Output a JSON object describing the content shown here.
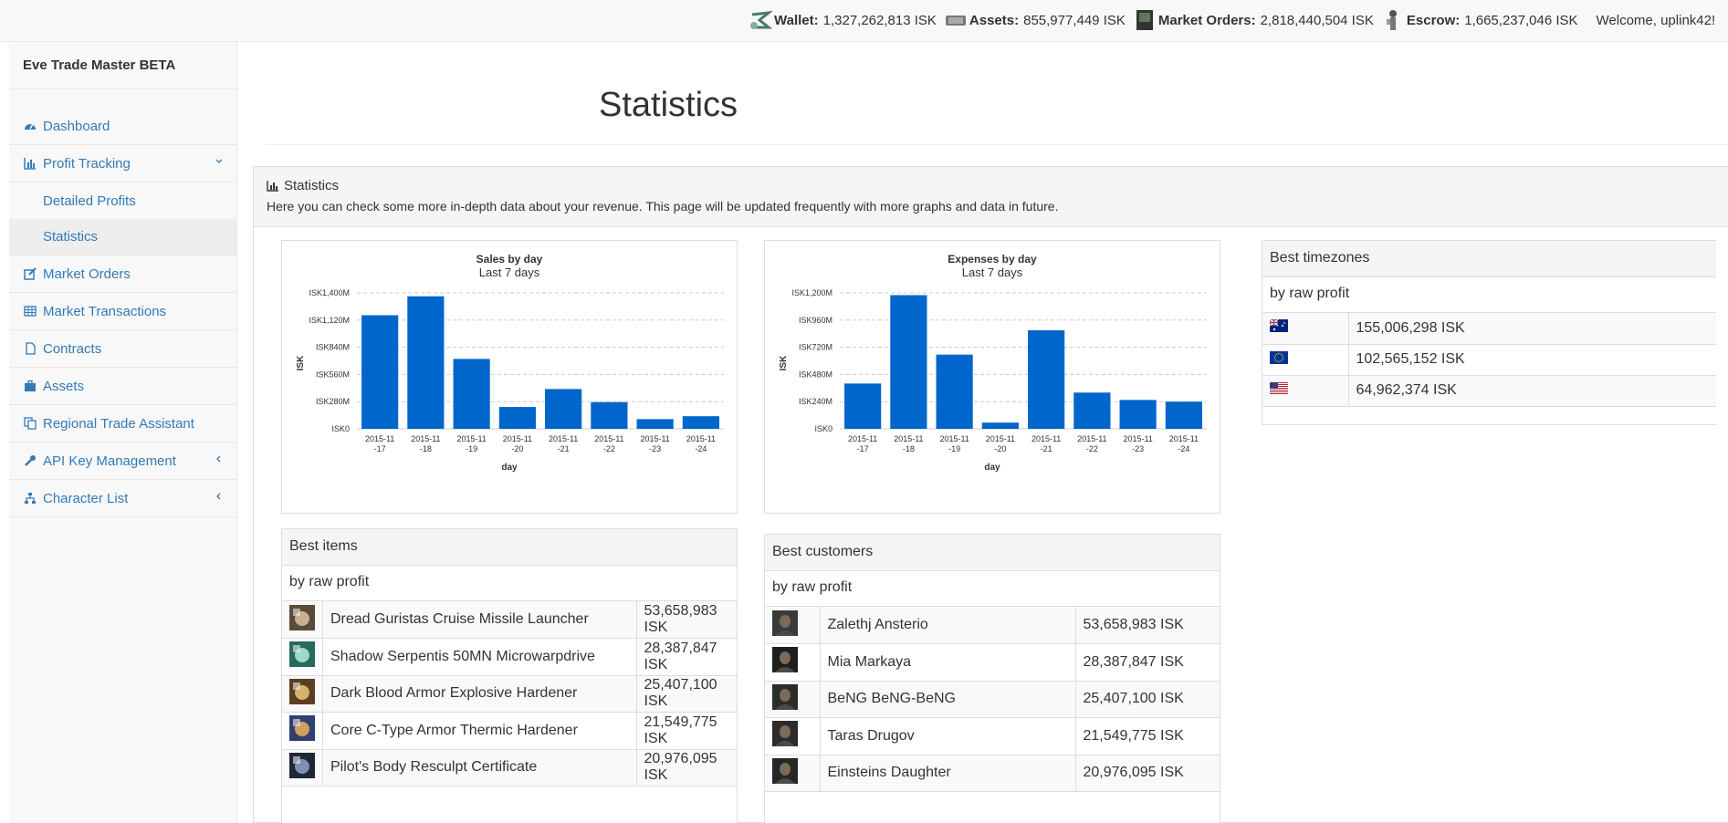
{
  "topbar": {
    "wallet_label": "Wallet:",
    "wallet_value": "1,327,262,813 ISK",
    "assets_label": "Assets:",
    "assets_value": "855,977,449 ISK",
    "orders_label": "Market Orders:",
    "orders_value": "2,818,440,504 ISK",
    "escrow_label": "Escrow:",
    "escrow_value": "1,665,237,046 ISK",
    "welcome": "Welcome, uplink42!"
  },
  "sidebar": {
    "brand": "Eve Trade Master BETA",
    "items": [
      {
        "label": "Dashboard",
        "icon": "dashboard-icon"
      },
      {
        "label": "Profit Tracking",
        "icon": "bar-chart-icon"
      },
      {
        "label": "Detailed Profits"
      },
      {
        "label": "Statistics"
      },
      {
        "label": "Market Orders",
        "icon": "edit-icon"
      },
      {
        "label": "Market Transactions",
        "icon": "table-icon"
      },
      {
        "label": "Contracts",
        "icon": "file-icon"
      },
      {
        "label": "Assets",
        "icon": "briefcase-icon"
      },
      {
        "label": "Regional Trade Assistant",
        "icon": "copy-icon"
      },
      {
        "label": "API Key Management",
        "icon": "wrench-icon"
      },
      {
        "label": "Character List",
        "icon": "sitemap-icon"
      }
    ]
  },
  "page": {
    "title": "Statistics",
    "panel_title": "Statistics",
    "panel_desc": "Here you can check some more in-depth data about your revenue. This page will be updated frequently with more graphs and data in future."
  },
  "chart_data": [
    {
      "type": "bar",
      "title": "Sales by day",
      "subtitle": "Last 7 days",
      "xlabel": "day",
      "ylabel": "ISK",
      "categories": [
        "2015-11-17",
        "2015-11-18",
        "2015-11-19",
        "2015-11-20",
        "2015-11-21",
        "2015-11-22",
        "2015-11-23",
        "2015-11-24"
      ],
      "values": [
        1170,
        1365,
        720,
        225,
        410,
        275,
        100,
        130
      ],
      "yticks": [
        "ISK0",
        "ISK280M",
        "ISK560M",
        "ISK840M",
        "ISK1,120M",
        "ISK1,400M"
      ],
      "ylim": [
        0,
        1400
      ],
      "grid": true,
      "color": "#0066cc"
    },
    {
      "type": "bar",
      "title": "Expenses by day",
      "subtitle": "Last 7 days",
      "xlabel": "day",
      "ylabel": "ISK",
      "categories": [
        "2015-11-17",
        "2015-11-18",
        "2015-11-19",
        "2015-11-20",
        "2015-11-21",
        "2015-11-22",
        "2015-11-23",
        "2015-11-24"
      ],
      "values": [
        400,
        1180,
        655,
        55,
        870,
        320,
        255,
        240
      ],
      "yticks": [
        "ISK0",
        "ISK240M",
        "ISK480M",
        "ISK720M",
        "ISK960M",
        "ISK1,200M"
      ],
      "ylim": [
        0,
        1200
      ],
      "grid": true,
      "color": "#0066cc"
    }
  ],
  "best_items": {
    "title": "Best items",
    "subtitle": "by raw profit",
    "rows": [
      {
        "name": "Dread Guristas Cruise Missile Launcher",
        "value": "53,658,983 ISK"
      },
      {
        "name": "Shadow Serpentis 50MN Microwarpdrive",
        "value": "28,387,847 ISK"
      },
      {
        "name": "Dark Blood Armor Explosive Hardener",
        "value": "25,407,100 ISK"
      },
      {
        "name": "Core C-Type Armor Thermic Hardener",
        "value": "21,549,775 ISK"
      },
      {
        "name": "Pilot's Body Resculpt Certificate",
        "value": "20,976,095 ISK"
      }
    ]
  },
  "best_customers": {
    "title": "Best customers",
    "subtitle": "by raw profit",
    "rows": [
      {
        "name": "Zalethj Ansterio",
        "value": "53,658,983 ISK"
      },
      {
        "name": "Mia Markaya",
        "value": "28,387,847 ISK"
      },
      {
        "name": "BeNG BeNG-BeNG",
        "value": "25,407,100 ISK"
      },
      {
        "name": "Taras Drugov",
        "value": "21,549,775 ISK"
      },
      {
        "name": "Einsteins Daughter",
        "value": "20,976,095 ISK"
      }
    ]
  },
  "best_timezones": {
    "title": "Best timezones",
    "subtitle": "by raw profit",
    "rows": [
      {
        "flag": "australia-flag-icon",
        "value": "155,006,298 ISK"
      },
      {
        "flag": "eu-flag-icon",
        "value": "102,565,152 ISK"
      },
      {
        "flag": "us-flag-icon",
        "value": "64,962,374 ISK"
      }
    ]
  }
}
